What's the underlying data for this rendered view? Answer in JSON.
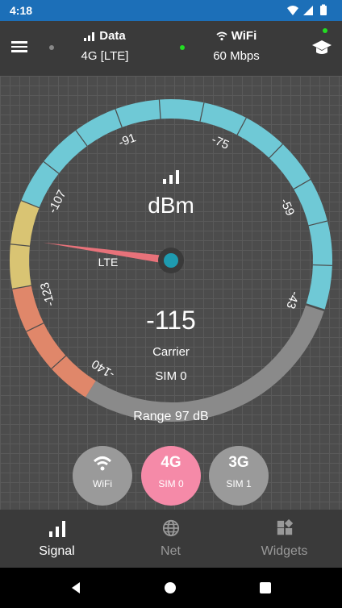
{
  "status_bar": {
    "time": "4:18",
    "icons": [
      "wifi-icon",
      "cell-signal-icon",
      "battery-icon"
    ],
    "color": "#1c6fb8"
  },
  "header": {
    "data": {
      "title": "Data",
      "value": "4G [LTE]",
      "indicator_color": "#888888"
    },
    "wifi": {
      "title": "WiFi",
      "value": "60 Mbps",
      "indicator_color": "#22dd22"
    },
    "learn_indicator_color": "#22dd22"
  },
  "gauge": {
    "scale_labels": [
      "-140",
      "-123",
      "-107",
      "-91",
      "-75",
      "-59",
      "-43"
    ],
    "unit": "dBm",
    "tech_label": "LTE",
    "reading": "-115",
    "reading_value": -115,
    "scale_min": -140,
    "scale_max": -43,
    "operator": "Carrier",
    "sim": "SIM 0",
    "range": "Range 97 dB",
    "colors": {
      "weak": "#e0876a",
      "fair": "#d9c473",
      "good": "#6fc9d6",
      "needle": "#e8727a",
      "hub": "#1e9bb0"
    }
  },
  "modes": [
    {
      "big": "",
      "icon": "wifi-icon",
      "small": "WiFi",
      "active": false
    },
    {
      "big": "4G",
      "small": "SIM 0",
      "active": true
    },
    {
      "big": "3G",
      "small": "SIM 1",
      "active": false
    }
  ],
  "nav": [
    {
      "label": "Signal",
      "icon": "signal-bars-icon",
      "active": true
    },
    {
      "label": "Net",
      "icon": "globe-icon",
      "active": false
    },
    {
      "label": "Widgets",
      "icon": "widgets-icon",
      "active": false
    }
  ],
  "accent": "#f58aa8"
}
